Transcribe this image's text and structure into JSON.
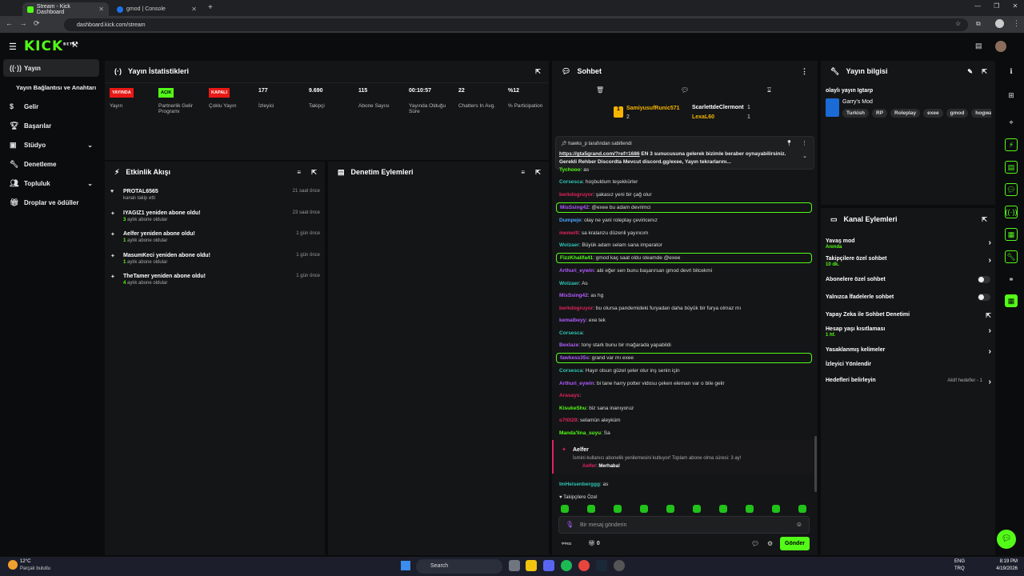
{
  "browser": {
    "tabs": [
      {
        "label": "Stream - Kick Dashboard",
        "active": true
      },
      {
        "label": "gmod | Console",
        "active": false
      }
    ],
    "url": "dashboard.kick.com/stream"
  },
  "kick": {
    "logo": "KICK",
    "logo_tag": "BETA"
  },
  "sidebar": {
    "items": [
      {
        "label": "Yayın",
        "icon": "broadcast-icon"
      },
      {
        "label": "Yayın Bağlantısı ve Anahtarı",
        "icon": ""
      },
      {
        "label": "Gelir",
        "icon": "dollar-icon"
      },
      {
        "label": "Başarılar",
        "icon": "trophy-icon"
      },
      {
        "label": "Stüdyo",
        "icon": "camera-icon"
      },
      {
        "label": "Denetleme",
        "icon": "wrench-icon"
      },
      {
        "label": "Topluluk",
        "icon": "people-icon"
      },
      {
        "label": "Droplar ve ödüller",
        "icon": "gift-icon"
      }
    ]
  },
  "stats": {
    "title": "Yayın İstatistikleri",
    "items": [
      {
        "badge": "YAYINDA",
        "badge_color": "#e91916",
        "label": "Yayın"
      },
      {
        "badge": "AÇIK",
        "badge_color": "#53fc18",
        "label": "Partnerlik Gelir Programı"
      },
      {
        "badge": "KAPALI",
        "badge_color": "#e91916",
        "label": "Çoklu Yayın"
      },
      {
        "value": "177",
        "label": "İzleyici"
      },
      {
        "value": "9.690",
        "label": "Takipçi"
      },
      {
        "value": "115",
        "label": "Abone Sayısı"
      },
      {
        "value": "00:10:57",
        "label": "Yayında Olduğu Süre"
      },
      {
        "value": "22",
        "label": "Chatters In Avg."
      },
      {
        "value": "%12",
        "label": "% Participation"
      }
    ]
  },
  "events": {
    "title": "Etkinlik Akışı",
    "items": [
      {
        "title": "PROTAL6565",
        "sub": "kanalı takip etti",
        "time": "21 saat önce",
        "icon": "heart-icon"
      },
      {
        "title": "IYAGIZ1 yeniden abone oldu!",
        "sub_num": "3",
        "sub": "aylık abone oldular",
        "time": "23 saat önce",
        "icon": "star-icon"
      },
      {
        "title": "Aelfer yeniden abone oldu!",
        "sub_num": "1",
        "sub": "aylık abone oldular",
        "time": "1 gün önce",
        "icon": "star-icon"
      },
      {
        "title": "MasumKeci yeniden abone oldu!",
        "sub_num": "1",
        "sub": "aylık abone oldular",
        "time": "1 gün önce",
        "icon": "star-icon"
      },
      {
        "title": "TheTamer yeniden abone oldu!",
        "sub_num": "4",
        "sub": "aylık abone oldular",
        "time": "1 gün önce",
        "icon": "star-icon"
      }
    ]
  },
  "moderation": {
    "title": "Denetim Eylemleri"
  },
  "chat": {
    "title": "Sohbet",
    "leaderboard": [
      {
        "rank": "1",
        "name": "SamiyusufRunic571",
        "count": "2"
      },
      {
        "name": "ScarlettdeClermont",
        "count": "1"
      },
      {
        "name": "LexaL60",
        "count": "1"
      }
    ],
    "pinned": {
      "by": "hawks_p tarafından sabitlendi",
      "link": "https://gta5grand.com/?ref=1686",
      "text": " EN 3 sunucusuna gelerek bizimle beraber oynayabilirsiniz. Gerekli Rehber Discordta Mevcut discord.gg/exee, Yayın tekrarlarını..."
    },
    "messages": [
      {
        "user": "Tychooo",
        "text": ": as",
        "color": "#53fc18"
      },
      {
        "user": "Corsesca",
        "text": ": hoşbuldum teşekkürler",
        "color": "#2ec4b6"
      },
      {
        "user": "berkdogruyor",
        "text": ": şakasız yeni bir çağ olur",
        "color": "#e0245e"
      },
      {
        "user": "MisSsing42",
        "text": ": @exee bu adam devrimci",
        "color": "#b05cff",
        "hl": true
      },
      {
        "user": "Dumpeje",
        "text": ": olay ne yani roleplay çeviricenız",
        "color": "#4aa3ff"
      },
      {
        "user": "memel0",
        "text": ": sa kralanzu düzenli yayıncım",
        "color": "#e0245e"
      },
      {
        "user": "Wolzaer",
        "text": ": Büyük adam selam sana imparator",
        "color": "#2ec4b6"
      },
      {
        "user": "FizzKhalifa41",
        "text": ": gmod kaç saat oldu steamde @exee",
        "color": "#53fc18",
        "hl": true
      },
      {
        "user": "Arthuri_eywin",
        "text": ": abi eğer sen bunu başarırsan gmod devri bitcekmi",
        "color": "#b05cff"
      },
      {
        "user": "Wolzaer",
        "text": ": As",
        "color": "#2ec4b6"
      },
      {
        "user": "MisSsing42",
        "text": ": as hg",
        "color": "#b05cff"
      },
      {
        "user": "berkdogruyor",
        "text": ": bu olursa pandemideki furyadan daha büyük bir furya olmaz mı",
        "color": "#e0245e"
      },
      {
        "user": "kemalbeyy",
        "text": ": exe tek",
        "color": "#b05cff"
      },
      {
        "user": "Corsesca",
        "text": ": ",
        "color": "#2ec4b6"
      },
      {
        "user": "Bexlaze",
        "text": ": tony stark bunu bir mağarada yapabildi",
        "color": "#b05cff"
      },
      {
        "user": "fawkess35s",
        "text": ": grand var mı exee",
        "color": "#b05cff",
        "hl": true
      },
      {
        "user": "Corsesca",
        "text": ": Hayır olsun güzel şeler olur inş senin için",
        "color": "#2ec4b6"
      },
      {
        "user": "Arthuri_eywin",
        "text": ": bi tane harry potter vidosu çeken eleman var o bile gelir",
        "color": "#b05cff"
      },
      {
        "user": "Arasays",
        "text": ": ",
        "color": "#e0245e"
      },
      {
        "user": "KisukeShu",
        "text": ": biz sana inanıyoruz",
        "color": "#53fc18"
      },
      {
        "user": "o7t0l29",
        "text": ": selamün aleyküm",
        "color": "#e0245e"
      },
      {
        "user": "Manda'lina_suyu",
        "text": ": Sa",
        "color": "#53fc18"
      }
    ],
    "sub_notice": {
      "name": "Aelfer",
      "text": "İsmini kullanıcı abonelik yenilemesini kutluyor! Toplam abone olma süresi: 3 ay!",
      "reply_user": "Aelfer",
      "reply_text": "Merhaba!"
    },
    "last": {
      "user": "ImHeisenberggg",
      "text": ": as"
    },
    "emote_label": "Takipçilere Özel",
    "input_placeholder": "Bir mesaj gönderin",
    "send": "Gönder",
    "count": "0"
  },
  "stream_info": {
    "title": "Yayın bilgisi",
    "stream_title": "olaylı yayın Igtarp",
    "category": "Garry's Mod",
    "tags": [
      "Turkish",
      "RP",
      "Roleplay",
      "exee",
      "gmod",
      "hogwar"
    ]
  },
  "channel_actions": {
    "title": "Kanal Eylemleri",
    "items": [
      {
        "label": "Yavaş mod",
        "sub": "Anında",
        "control": "chevron"
      },
      {
        "label": "Takipçilere özel sohbet",
        "sub": "10 dk.",
        "control": "chevron"
      },
      {
        "label": "Abonelere özel sohbet",
        "control": "toggle"
      },
      {
        "label": "Yalnızca İfadelerle sohbet",
        "control": "toggle"
      },
      {
        "label": "Yapay Zeka ile Sohbet Denetimi",
        "control": "external"
      },
      {
        "label": "Hesap yaşı kısıtlaması",
        "sub": "1 hf.",
        "control": "chevron"
      },
      {
        "label": "Yasaklanmış kelimeler",
        "control": "chevron"
      },
      {
        "label": "İzleyici Yönlendir",
        "control": "none"
      },
      {
        "label": "Hedefleri belirleyin",
        "right": "Aktif hedefler - 1",
        "control": "chevron"
      }
    ]
  },
  "taskbar": {
    "weather_temp": "12°C",
    "weather_text": "Parçalı bulutlu",
    "search": "Search",
    "lang": "ENG",
    "region": "TRQ",
    "time": "8:19 PM",
    "date": "4/19/2026"
  },
  "colors": {
    "accent": "#53fc18",
    "live": "#e91916",
    "panel": "#141516",
    "bg": "#0b0c0d"
  }
}
